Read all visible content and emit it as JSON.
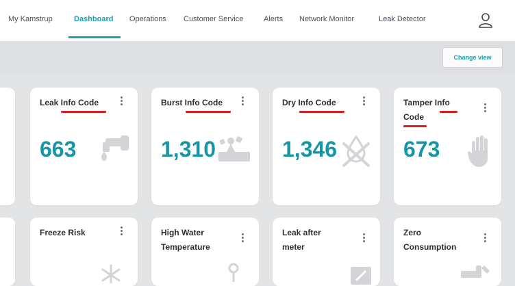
{
  "nav": {
    "items": [
      {
        "label": "My Kamstrup"
      },
      {
        "label": "Dashboard",
        "active": true
      },
      {
        "label": "Operations"
      },
      {
        "label": "Customer Service"
      },
      {
        "label": "Alerts"
      },
      {
        "label": "Network Monitor"
      },
      {
        "label": "Leak Detector"
      }
    ],
    "user_icon": "user-icon"
  },
  "toolbar": {
    "change_view_label": "Change view"
  },
  "cards": [
    {
      "title": "Leak Info Code",
      "value": "663",
      "icon": "faucet-drop-icon"
    },
    {
      "title": "Burst Info Code",
      "value": "1,310",
      "icon": "burst-pipe-icon"
    },
    {
      "title": "Dry Info Code",
      "value": "1,346",
      "icon": "dry-drop-icon"
    },
    {
      "title": "Tamper Info Code",
      "value": "673",
      "icon": "hand-icon"
    },
    {
      "title": "Freeze Risk",
      "icon": "snowflake-icon"
    },
    {
      "title": "High Water Temperature",
      "icon": "thermometer-icon"
    },
    {
      "title": "Leak after meter",
      "icon": "meter-leak-icon"
    },
    {
      "title": "Zero Consumption",
      "icon": "zero-flow-icon"
    }
  ],
  "colors": {
    "accent": "#17a2ad",
    "value": "#1596a6",
    "annotation": "#d32222",
    "background": "#e3e4e6"
  }
}
